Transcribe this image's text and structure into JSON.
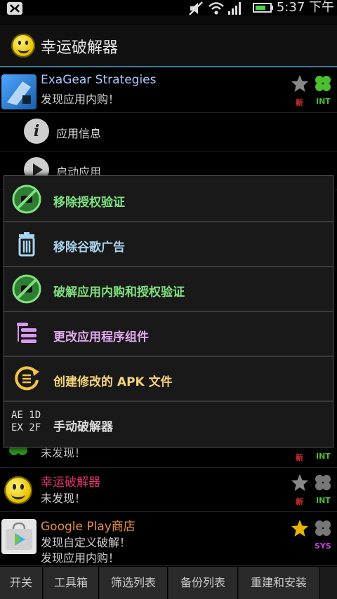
{
  "status_bar": {
    "time": "5:37 下午"
  },
  "action_bar": {
    "title": "幸运破解器"
  },
  "apps": [
    {
      "name": "ExaGear Strategies",
      "status": "发现应用内购！",
      "tag_left": "新",
      "tag_right": "INT",
      "name_color": "#a9c7ff"
    },
    {
      "status": "未发现！",
      "tag_left": "新",
      "tag_right": "INT"
    },
    {
      "name": "幸运破解器",
      "status": "未发现！",
      "tag_left": "新",
      "tag_right": "INT",
      "name_color": "#e0306a"
    },
    {
      "name": "Google Play商店",
      "status_line1": "发现自定义破解！",
      "status_line2": "发现应用内购！",
      "tag_right": "SYS",
      "name_color": "#e8913a"
    }
  ],
  "submenu": {
    "app_info": "应用信息",
    "launch_app": "启动应用"
  },
  "dialog": {
    "items": [
      {
        "label": "移除授权验证",
        "color": "#7fe07f",
        "icon": "no-license-icon"
      },
      {
        "label": "移除谷歌广告",
        "color": "#a9d4f0",
        "icon": "trash-icon"
      },
      {
        "label": "破解应用内购和授权验证",
        "color": "#7fe07f",
        "icon": "no-license-icon"
      },
      {
        "label": "更改应用程序组件",
        "color": "#e0a9f0",
        "icon": "components-icon"
      },
      {
        "label": "创建修改的 APK 文件",
        "color": "#f5d27a",
        "icon": "rebuild-apk-icon"
      },
      {
        "label": "手动破解器",
        "color": "#dddddd",
        "icon": "hex-patch-icon",
        "icon_text_1": "AE 1D",
        "icon_text_2": "EX 2F"
      }
    ]
  },
  "tabs": [
    "开关",
    "工具箱",
    "筛选列表",
    "备份列表",
    "重建和安装"
  ]
}
